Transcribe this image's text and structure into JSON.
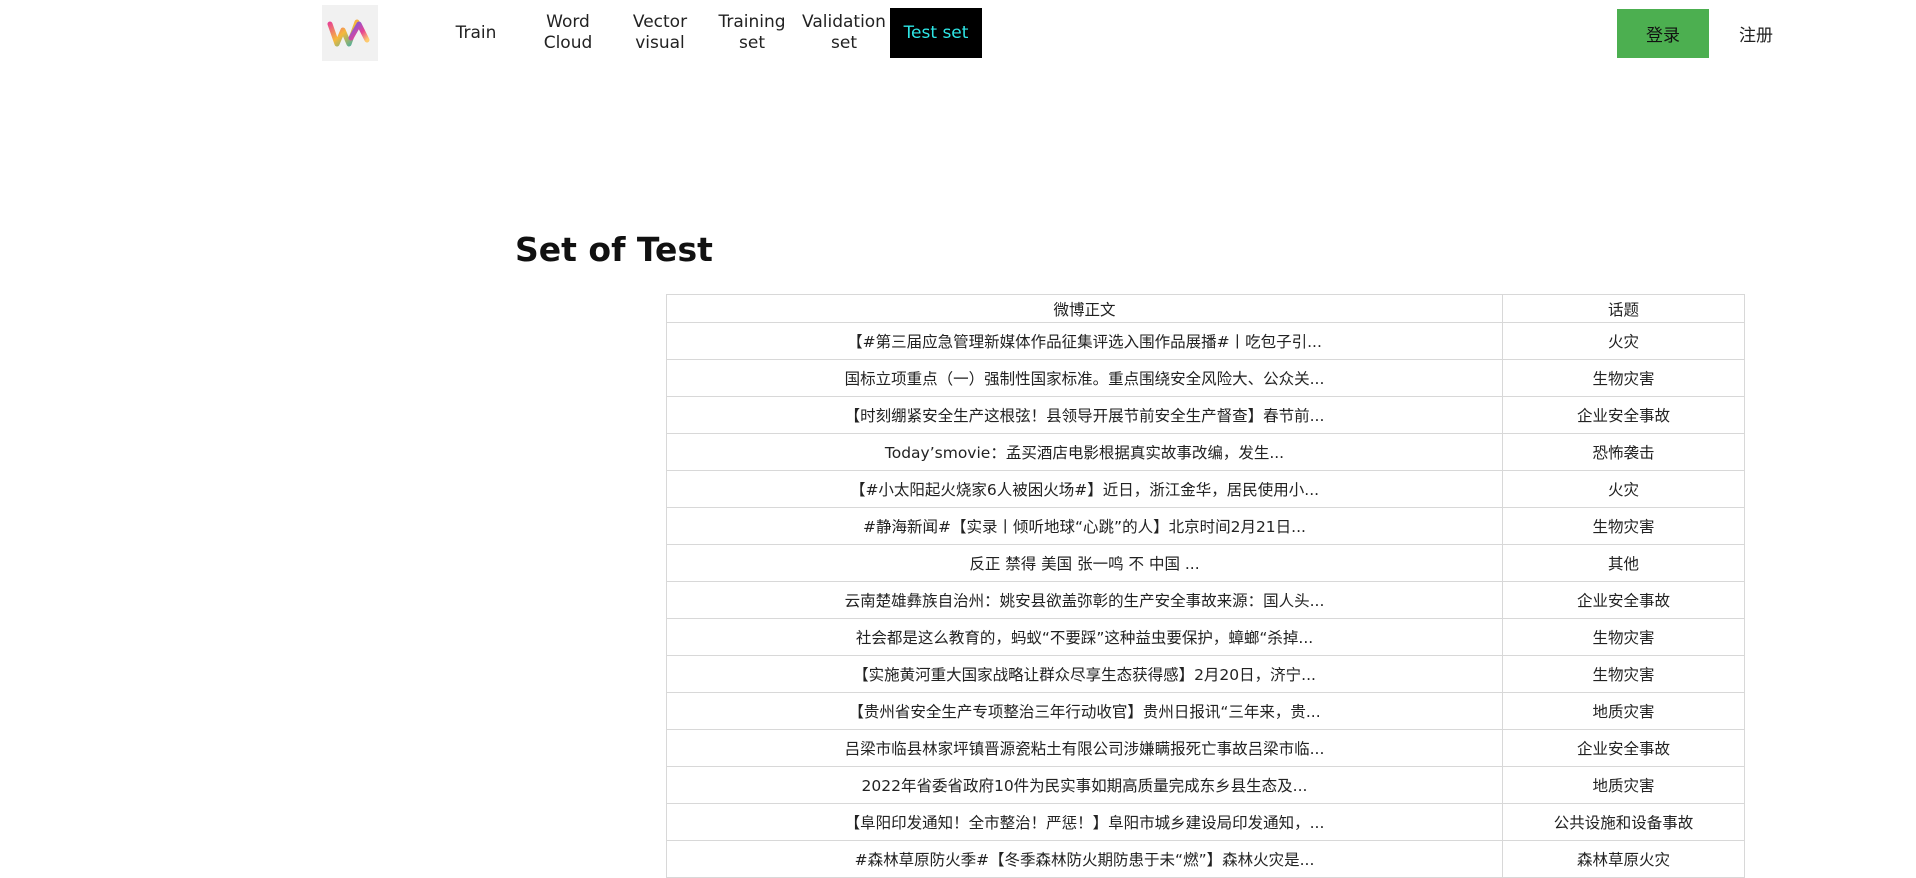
{
  "nav": {
    "items": [
      {
        "label": "Train"
      },
      {
        "label": "Word Cloud"
      },
      {
        "label": "Vector visual"
      },
      {
        "label": "Training set"
      },
      {
        "label": "Validation set"
      },
      {
        "label": "Test set",
        "active": true
      }
    ],
    "active_bg": "#000000",
    "active_color": "#2ee6e6"
  },
  "auth": {
    "login_label": "登录",
    "register_label": "注册",
    "login_color": "#4caf50"
  },
  "page": {
    "title": "Set of Test"
  },
  "table": {
    "headers": [
      "微博正文",
      "话题"
    ],
    "rows": [
      [
        "【#第三届应急管理新媒体作品征集评选入围作品展播#丨吃包子引...",
        "火灾"
      ],
      [
        "国标立项重点（一）强制性国家标准。重点围绕安全风险大、公众关...",
        "生物灾害"
      ],
      [
        "【时刻绷紧安全生产这根弦！县领导开展节前安全生产督查】春节前...",
        "企业安全事故"
      ],
      [
        "Today’smovie：孟买酒店电影根据真实故事改编，发生...",
        "恐怖袭击"
      ],
      [
        "【#小太阳起火烧家6人被困火场#】近日，浙江金华，居民使用小...",
        "火灾"
      ],
      [
        "#静海新闻#【实录丨倾听地球“心跳”的人】北京时间2月21日...",
        "生物灾害"
      ],
      [
        "反正 禁得 美国 张一鸣 不 中国 ...",
        "其他"
      ],
      [
        "云南楚雄彝族自治州：姚安县欲盖弥彰的生产安全事故来源：国人头...",
        "企业安全事故"
      ],
      [
        "社会都是这么教育的，蚂蚁“不要踩”这种益虫要保护，蟑螂“杀掉...",
        "生物灾害"
      ],
      [
        "【实施黄河重大国家战略让群众尽享生态获得感】2月20日，济宁...",
        "生物灾害"
      ],
      [
        "【贵州省安全生产专项整治三年行动收官】贵州日报讯“三年来，贵...",
        "地质灾害"
      ],
      [
        "吕梁市临县林家坪镇晋源瓷粘土有限公司涉嫌瞒报死亡事故吕梁市临...",
        "企业安全事故"
      ],
      [
        "2022年省委省政府10件为民实事如期高质量完成东乡县生态及...",
        "地质灾害"
      ],
      [
        "【阜阳印发通知！全市整治！严惩！】阜阳市城乡建设局印发通知，...",
        "公共设施和设备事故"
      ],
      [
        "#森林草原防火季#【冬季森林防火期防患于未“燃”】森林火灾是...",
        "森林草原火灾"
      ]
    ]
  }
}
